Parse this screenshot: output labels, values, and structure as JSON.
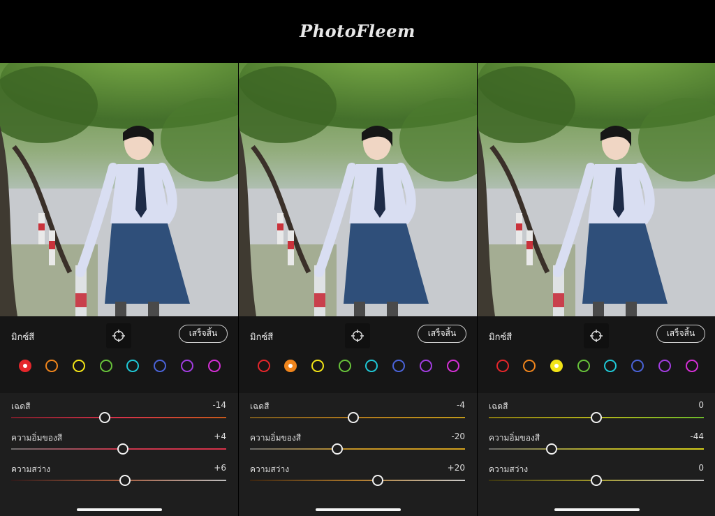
{
  "brand": {
    "name": "PhotoFleem"
  },
  "panels": [
    {
      "mix_label": "มิกซ์สี",
      "target_icon": "target-adjust-icon",
      "done_label": "เสร็จสิ้น",
      "selected_color": "red",
      "sliders": [
        {
          "label": "เฉดสี",
          "value": "-14",
          "level": 0.43
        },
        {
          "label": "ความอิ่มของสี",
          "value": "+4",
          "level": 0.52
        },
        {
          "label": "ความสว่าง",
          "value": "+6",
          "level": 0.53
        }
      ]
    },
    {
      "mix_label": "มิกซ์สี",
      "target_icon": "target-adjust-icon",
      "done_label": "เสร็จสิ้น",
      "selected_color": "orange",
      "sliders": [
        {
          "label": "เฉดสี",
          "value": "-4",
          "level": 0.48
        },
        {
          "label": "ความอิ่มของสี",
          "value": "-20",
          "level": 0.4
        },
        {
          "label": "ความสว่าง",
          "value": "+20",
          "level": 0.6
        }
      ]
    },
    {
      "mix_label": "มิกซ์สี",
      "target_icon": "target-adjust-icon",
      "done_label": "เสร็จสิ้น",
      "selected_color": "yellow",
      "sliders": [
        {
          "label": "เฉดสี",
          "value": "0",
          "level": 0.5
        },
        {
          "label": "ความอิ่มของสี",
          "value": "-44",
          "level": 0.28
        },
        {
          "label": "ความสว่าง",
          "value": "0",
          "level": 0.5
        }
      ]
    }
  ],
  "swatch_colors": [
    {
      "name": "red",
      "hex": "#e5262b"
    },
    {
      "name": "orange",
      "hex": "#f0851c"
    },
    {
      "name": "yellow",
      "hex": "#f2e416"
    },
    {
      "name": "green",
      "hex": "#67c23a"
    },
    {
      "name": "aqua",
      "hex": "#1fc8d6"
    },
    {
      "name": "blue",
      "hex": "#4a63d8"
    },
    {
      "name": "purple",
      "hex": "#a23de0"
    },
    {
      "name": "magenta",
      "hex": "#d52fd6"
    }
  ],
  "track_colors": {
    "hue": [
      "#d8324a",
      "#d8324a",
      "#c7591a"
    ],
    "saturation": [
      "#8a8a8a",
      "#d2354c",
      "#d2354c"
    ],
    "luminance": [
      "#3b1c20",
      "#c9a27f",
      "#c8c8c8"
    ]
  }
}
